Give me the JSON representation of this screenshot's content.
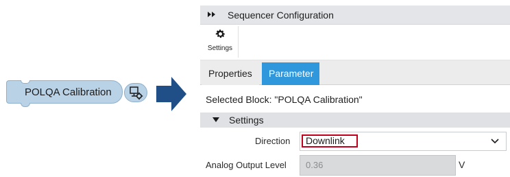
{
  "block": {
    "label": "POLQA Calibration",
    "icon": "parameter-gear-icon"
  },
  "panel": {
    "title": "Sequencer Configuration",
    "title_icon": "double-chevron-icon",
    "toolbar": {
      "settings_label": "Settings",
      "settings_icon": "gear-icon"
    },
    "tabs": [
      {
        "label": "Properties",
        "active": false
      },
      {
        "label": "Parameter",
        "active": true
      }
    ],
    "selected_block_text": "Selected Block: \"POLQA Calibration\"",
    "group": {
      "label": "Settings",
      "expanded": true
    },
    "fields": {
      "direction": {
        "label": "Direction",
        "value": "Downlink"
      },
      "analog_output_level": {
        "label": "Analog Output Level",
        "value": "0.36",
        "unit": "V"
      }
    }
  },
  "colors": {
    "block_fill": "#b9d2e6",
    "arrow": "#1f4f86",
    "active_tab": "#2f97dc",
    "highlight_border": "#c0001a"
  }
}
